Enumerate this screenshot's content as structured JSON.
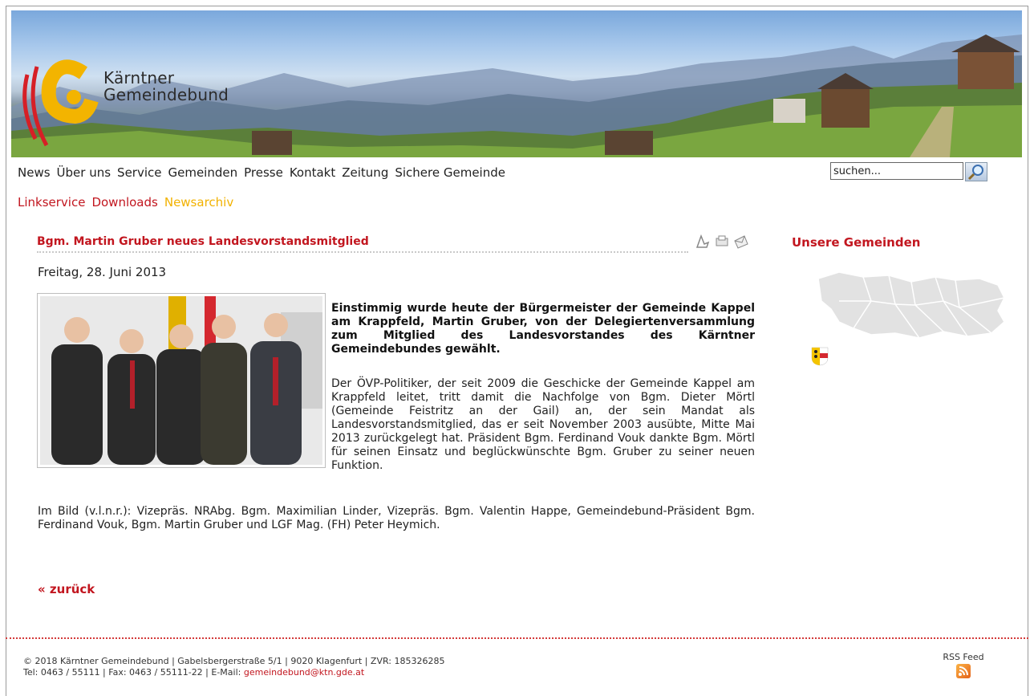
{
  "brand": {
    "line1": "Kärntner",
    "line2": "Gemeindebund"
  },
  "nav": [
    "News",
    "Über uns",
    "Service",
    "Gemeinden",
    "Presse",
    "Kontakt",
    "Zeitung",
    "Sichere Gemeinde"
  ],
  "search": {
    "value": "suchen..."
  },
  "subnav": [
    {
      "label": "Linkservice",
      "active": false
    },
    {
      "label": "Downloads",
      "active": false
    },
    {
      "label": "Newsarchiv",
      "active": true
    }
  ],
  "article": {
    "title": "Bgm. Martin Gruber neues Landesvorstandsmitglied",
    "date": "Freitag, 28. Juni 2013",
    "lead": "Einstimmig wurde heute der Bürgermeister der Gemeinde Kappel am Krappfeld, Martin Gruber, von der Delegiertenversammlung zum Mitglied des Landesvorstandes des Kärntner Gemeindebundes gewählt.",
    "body1": "Der ÖVP-Politiker, der seit 2009 die Geschicke der Gemeinde Kappel am Krappfeld leitet, tritt damit die Nachfolge von Bgm. Dieter Mörtl (Gemeinde Feistritz an der Gail) an, der sein Mandat als Landesvorstandsmitglied, das er seit November 2003 ausübte, Mitte Mai 2013 zurückgelegt hat. Präsident Bgm. Ferdinand Vouk dankte Bgm. Mörtl für seinen Einsatz und beglückwünschte Bgm. Gruber zu seiner neuen Funktion.",
    "body2": "Im Bild (v.l.n.r.): Vizepräs. NRAbg. Bgm. Maximilian Linder, Vizepräs. Bgm. Valentin Happe, Gemeindebund-Präsident Bgm. Ferdinand Vouk, Bgm. Martin Gruber und LGF Mag. (FH) Peter Heymich.",
    "back": "« zurück",
    "tools": [
      "pdf-icon",
      "print-icon",
      "email-icon"
    ]
  },
  "sidebar": {
    "title": "Unsere Gemeinden"
  },
  "footer": {
    "line1": "© 2018 Kärntner Gemeindebund | Gabelsbergerstraße 5/1 | 9020 Klagenfurt | ZVR: 185326285",
    "line2_prefix": "Tel: 0463 / 55111 | Fax: 0463 / 55111-22 | E-Mail: ",
    "email": "gemeindebund@ktn.gde.at",
    "rss_label": "RSS Feed"
  },
  "colors": {
    "accent": "#c2161f",
    "active": "#f2b200"
  }
}
